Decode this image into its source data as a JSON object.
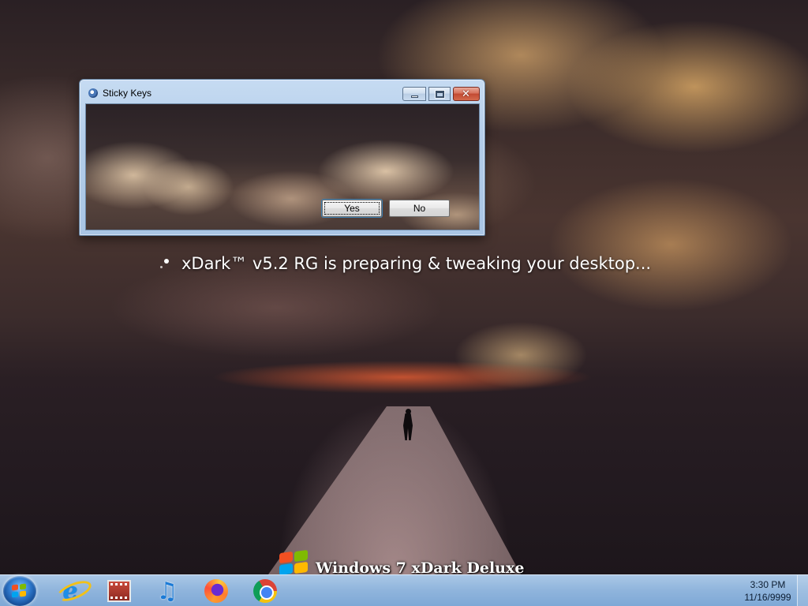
{
  "window": {
    "title": "Sticky Keys",
    "buttons": {
      "yes_label": "Yes",
      "no_label": "No"
    },
    "caption": {
      "close_glyph": "✕"
    }
  },
  "desktop": {
    "status_text": "xDark™ v5.2 RG is preparing & tweaking your desktop...",
    "branding_text": "Windows 7 xDark Deluxe"
  },
  "taskbar": {
    "apps": [
      "internet-explorer",
      "media-center",
      "itunes",
      "firefox",
      "chrome"
    ],
    "itunes_glyph": "♫",
    "ie_glyph": "e",
    "clock": {
      "time": "3:30 PM",
      "date": "11/16/9999"
    }
  },
  "colors": {
    "taskbar": "#8fb4dc",
    "close_button": "#c24a33",
    "window_frame": "#b3cde9"
  }
}
